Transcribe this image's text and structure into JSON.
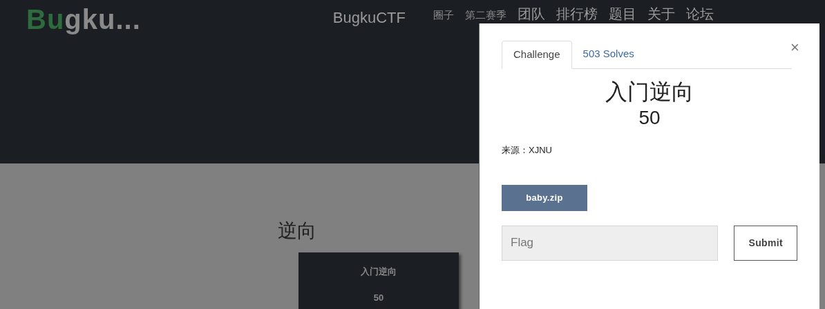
{
  "logo": [
    {
      "text": "Bu",
      "color": "#2e6b3e"
    },
    {
      "text": "gku...",
      "color": "#8a8a8a"
    }
  ],
  "site_title": "BugkuCTF",
  "nav": [
    {
      "label": "圈子",
      "kind": "small"
    },
    {
      "label": "第二赛季",
      "kind": "small"
    },
    {
      "label": "团队",
      "kind": "large"
    },
    {
      "label": "排行榜",
      "kind": "large"
    },
    {
      "label": "题目",
      "kind": "large"
    },
    {
      "label": "关于",
      "kind": "large"
    },
    {
      "label": "论坛",
      "kind": "large"
    }
  ],
  "category": "逆向",
  "challenge_card": {
    "name": "入门逆向",
    "points": "50"
  },
  "modal": {
    "tabs": [
      {
        "label": "Challenge",
        "selected": true
      },
      {
        "label": "503 Solves",
        "selected": false
      }
    ],
    "close": "×",
    "title": "入门逆向",
    "points": "50",
    "description": "来源：XJNU",
    "file_button": "baby.zip",
    "flag_field": {
      "placeholder": "Flag"
    },
    "submit_button": "Submit"
  }
}
